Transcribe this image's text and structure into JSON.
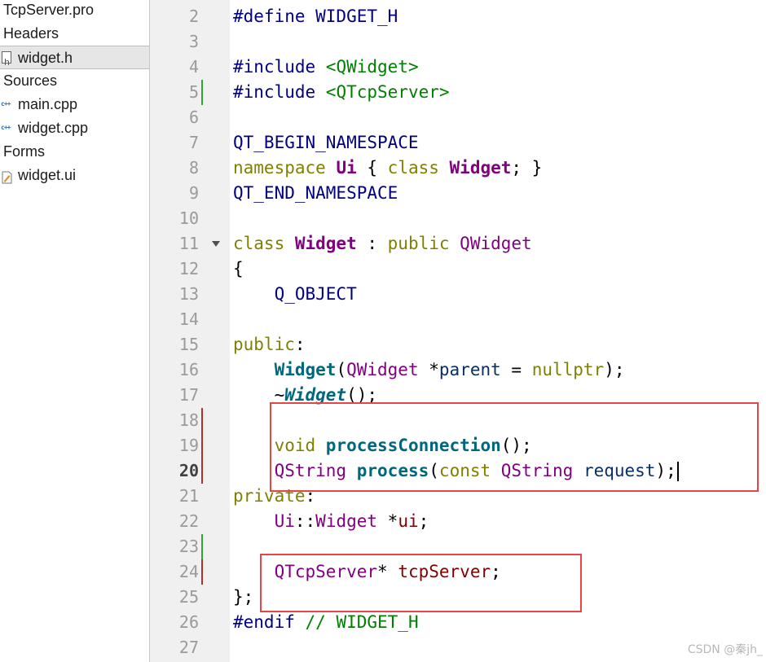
{
  "project_tree": [
    {
      "label": "TcpServer.pro",
      "indent": 0,
      "icon": "none"
    },
    {
      "label": "Headers",
      "indent": 0,
      "icon": "none"
    },
    {
      "label": "widget.h",
      "indent": 1,
      "icon": "header-file-icon",
      "selected": true
    },
    {
      "label": "Sources",
      "indent": 0,
      "icon": "none"
    },
    {
      "label": "main.cpp",
      "indent": 1,
      "icon": "cpp-file-icon"
    },
    {
      "label": "widget.cpp",
      "indent": 1,
      "icon": "cpp-file-icon"
    },
    {
      "label": "Forms",
      "indent": 0,
      "icon": "none"
    },
    {
      "label": "widget.ui",
      "indent": 1,
      "icon": "ui-file-icon"
    }
  ],
  "cpp_icon_glyph": "c++",
  "editor": {
    "current_line": "20",
    "lines": [
      {
        "n": "2",
        "mark": "",
        "fold": false,
        "tokens": [
          [
            "mac",
            "#define WIDGET_H"
          ]
        ]
      },
      {
        "n": "3",
        "mark": "",
        "fold": false,
        "tokens": []
      },
      {
        "n": "4",
        "mark": "",
        "fold": false,
        "tokens": [
          [
            "mac",
            "#include "
          ],
          [
            "str",
            "<QWidget>"
          ]
        ]
      },
      {
        "n": "5",
        "mark": "green",
        "fold": false,
        "tokens": [
          [
            "mac",
            "#include "
          ],
          [
            "str",
            "<QTcpServer>"
          ]
        ]
      },
      {
        "n": "6",
        "mark": "",
        "fold": false,
        "tokens": []
      },
      {
        "n": "7",
        "mark": "",
        "fold": false,
        "tokens": [
          [
            "mac",
            "QT_BEGIN_NAMESPACE"
          ]
        ]
      },
      {
        "n": "8",
        "mark": "",
        "fold": false,
        "tokens": [
          [
            "kw",
            "namespace "
          ],
          [
            "tyb",
            "Ui"
          ],
          [
            "plain",
            " { "
          ],
          [
            "kw",
            "class "
          ],
          [
            "tyb",
            "Widget"
          ],
          [
            "plain",
            "; }"
          ]
        ]
      },
      {
        "n": "9",
        "mark": "",
        "fold": false,
        "tokens": [
          [
            "mac",
            "QT_END_NAMESPACE"
          ]
        ]
      },
      {
        "n": "10",
        "mark": "",
        "fold": false,
        "tokens": []
      },
      {
        "n": "11",
        "mark": "",
        "fold": true,
        "tokens": [
          [
            "kw",
            "class "
          ],
          [
            "tyb",
            "Widget"
          ],
          [
            "plain",
            " : "
          ],
          [
            "kw",
            "public "
          ],
          [
            "ty",
            "QWidget"
          ]
        ]
      },
      {
        "n": "12",
        "mark": "",
        "fold": false,
        "tokens": [
          [
            "plain",
            "{"
          ]
        ]
      },
      {
        "n": "13",
        "mark": "",
        "fold": false,
        "tokens": [
          [
            "plain",
            "    "
          ],
          [
            "mac",
            "Q_OBJECT"
          ]
        ]
      },
      {
        "n": "14",
        "mark": "",
        "fold": false,
        "tokens": []
      },
      {
        "n": "15",
        "mark": "",
        "fold": false,
        "tokens": [
          [
            "kw",
            "public"
          ],
          [
            "plain",
            ":"
          ]
        ]
      },
      {
        "n": "16",
        "mark": "",
        "fold": false,
        "tokens": [
          [
            "plain",
            "    "
          ],
          [
            "fn",
            "Widget"
          ],
          [
            "plain",
            "("
          ],
          [
            "ty",
            "QWidget"
          ],
          [
            "plain",
            " *"
          ],
          [
            "var",
            "parent"
          ],
          [
            "plain",
            " = "
          ],
          [
            "kw",
            "nullptr"
          ],
          [
            "plain",
            ");"
          ]
        ]
      },
      {
        "n": "17",
        "mark": "",
        "fold": false,
        "tokens": [
          [
            "plain",
            "    ~"
          ],
          [
            "fni",
            "Widget"
          ],
          [
            "plain",
            "();"
          ]
        ]
      },
      {
        "n": "18",
        "mark": "red",
        "fold": false,
        "tokens": []
      },
      {
        "n": "19",
        "mark": "red",
        "fold": false,
        "tokens": [
          [
            "plain",
            "    "
          ],
          [
            "kw",
            "void "
          ],
          [
            "fn",
            "processConnection"
          ],
          [
            "plain",
            "();"
          ]
        ]
      },
      {
        "n": "20",
        "mark": "red",
        "fold": false,
        "cursor": true,
        "tokens": [
          [
            "plain",
            "    "
          ],
          [
            "ty",
            "QString"
          ],
          [
            "plain",
            " "
          ],
          [
            "fn",
            "process"
          ],
          [
            "plain",
            "("
          ],
          [
            "kw",
            "const "
          ],
          [
            "ty",
            "QString"
          ],
          [
            "plain",
            " "
          ],
          [
            "var",
            "request"
          ],
          [
            "plain",
            ");"
          ]
        ]
      },
      {
        "n": "21",
        "mark": "",
        "fold": false,
        "tokens": [
          [
            "kw",
            "private"
          ],
          [
            "plain",
            ":"
          ]
        ]
      },
      {
        "n": "22",
        "mark": "",
        "fold": false,
        "tokens": [
          [
            "plain",
            "    "
          ],
          [
            "ty",
            "Ui"
          ],
          [
            "plain",
            "::"
          ],
          [
            "ty",
            "Widget"
          ],
          [
            "plain",
            " *"
          ],
          [
            "mem",
            "ui"
          ],
          [
            "plain",
            ";"
          ]
        ]
      },
      {
        "n": "23",
        "mark": "green",
        "fold": false,
        "tokens": []
      },
      {
        "n": "24",
        "mark": "red",
        "fold": false,
        "tokens": [
          [
            "plain",
            "    "
          ],
          [
            "ty",
            "QTcpServer"
          ],
          [
            "plain",
            "* "
          ],
          [
            "mem",
            "tcpServer"
          ],
          [
            "plain",
            ";"
          ]
        ]
      },
      {
        "n": "25",
        "mark": "",
        "fold": false,
        "tokens": [
          [
            "plain",
            "};"
          ]
        ]
      },
      {
        "n": "26",
        "mark": "",
        "fold": false,
        "tokens": [
          [
            "mac",
            "#endif "
          ],
          [
            "cmt",
            "// WIDGET_H"
          ]
        ]
      },
      {
        "n": "27",
        "mark": "",
        "fold": false,
        "tokens": []
      }
    ]
  },
  "colors": {
    "mark_green": "#2fa82f",
    "mark_red": "#b03030",
    "highlight_box": "#e64545"
  },
  "watermark": "CSDN @秦jh_"
}
